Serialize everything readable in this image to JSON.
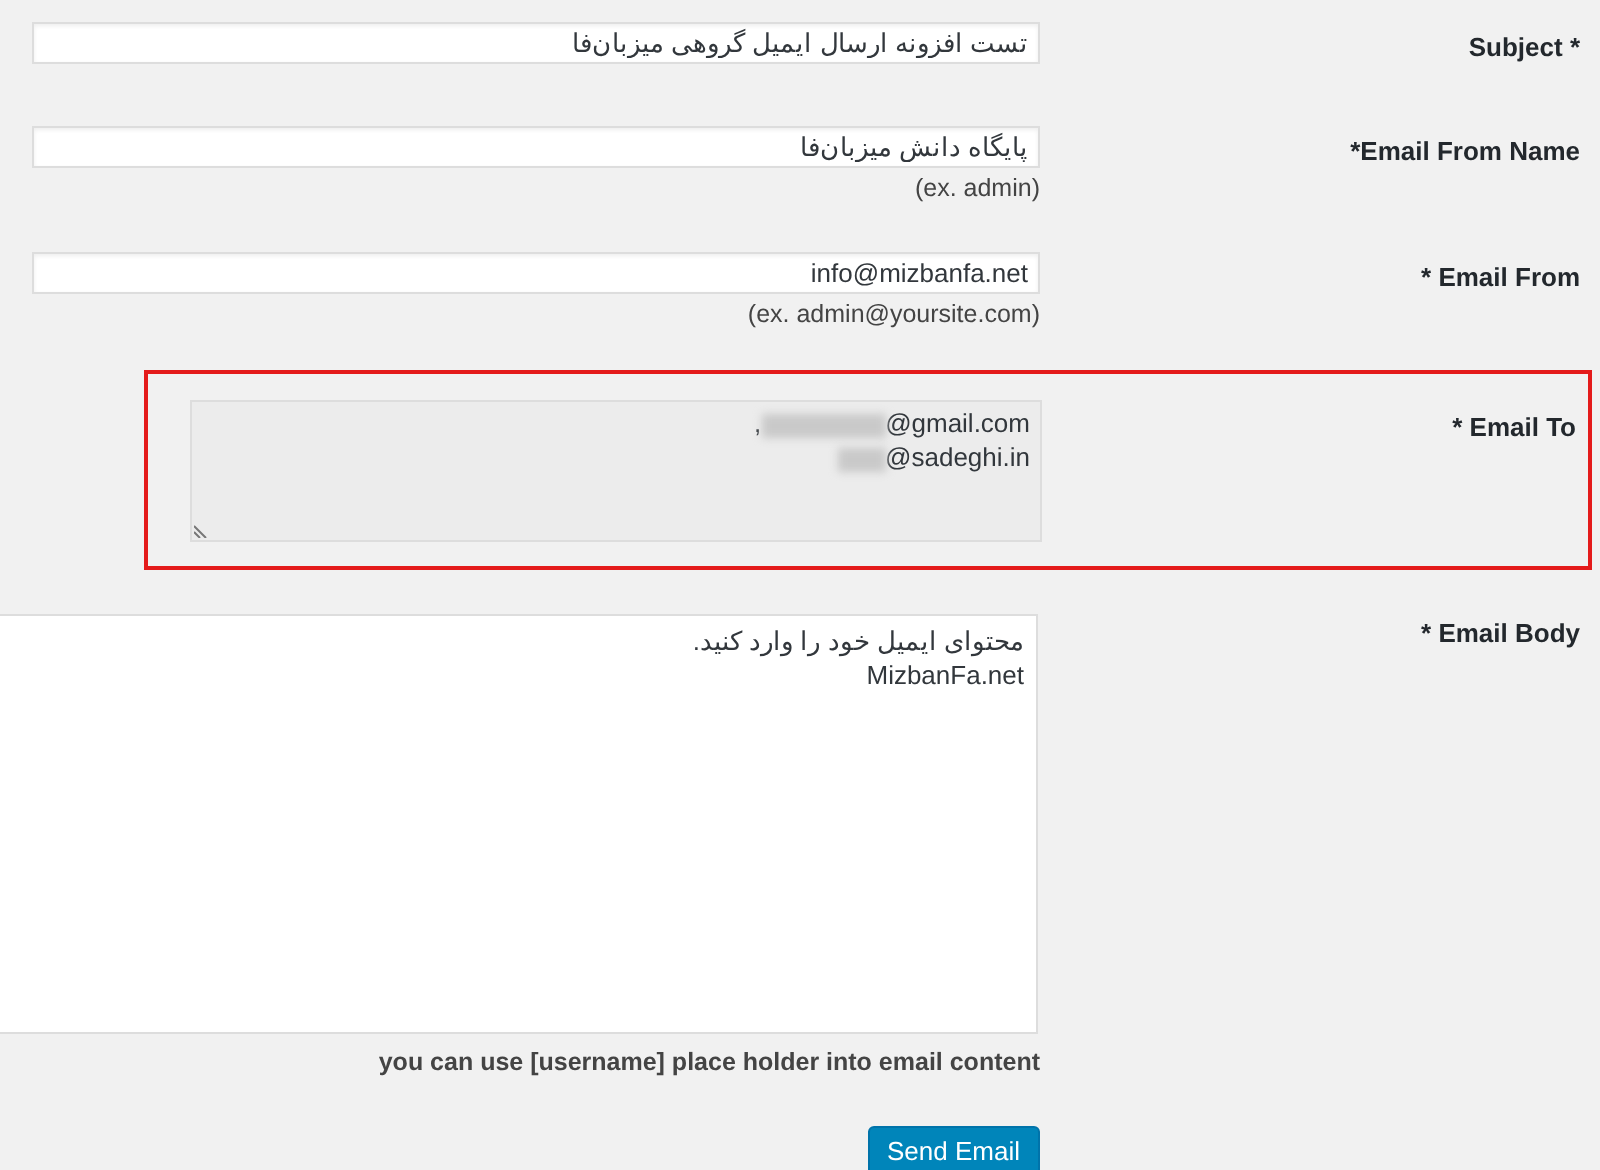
{
  "fields": [
    {
      "kind": "input",
      "label": "Subject *",
      "value": "تست افزونه ارسال ایمیل گروهی میزبان‌فا"
    },
    {
      "kind": "input",
      "label": "*Email From Name",
      "value": "پایگاه دانش میزبان‌فا",
      "hint": "(ex. admin)"
    },
    {
      "kind": "input",
      "label": "* Email From",
      "value": "info@mizbanfa.net",
      "hint": "(ex. admin@yoursite.com)"
    },
    {
      "kind": "recipients",
      "label": "* Email To",
      "highlighted": true,
      "recipients": [
        {
          "visible": "@gmail.com",
          "separator": ","
        },
        {
          "visible": "@sadeghi.in"
        }
      ]
    },
    {
      "kind": "body",
      "label": "* Email Body",
      "lines": [
        "محتوای ایمیل خود را وارد کنید.",
        "MizbanFa.net"
      ],
      "note": "you can use [username] place holder into email content"
    }
  ],
  "submit": {
    "label": "Send Email"
  }
}
